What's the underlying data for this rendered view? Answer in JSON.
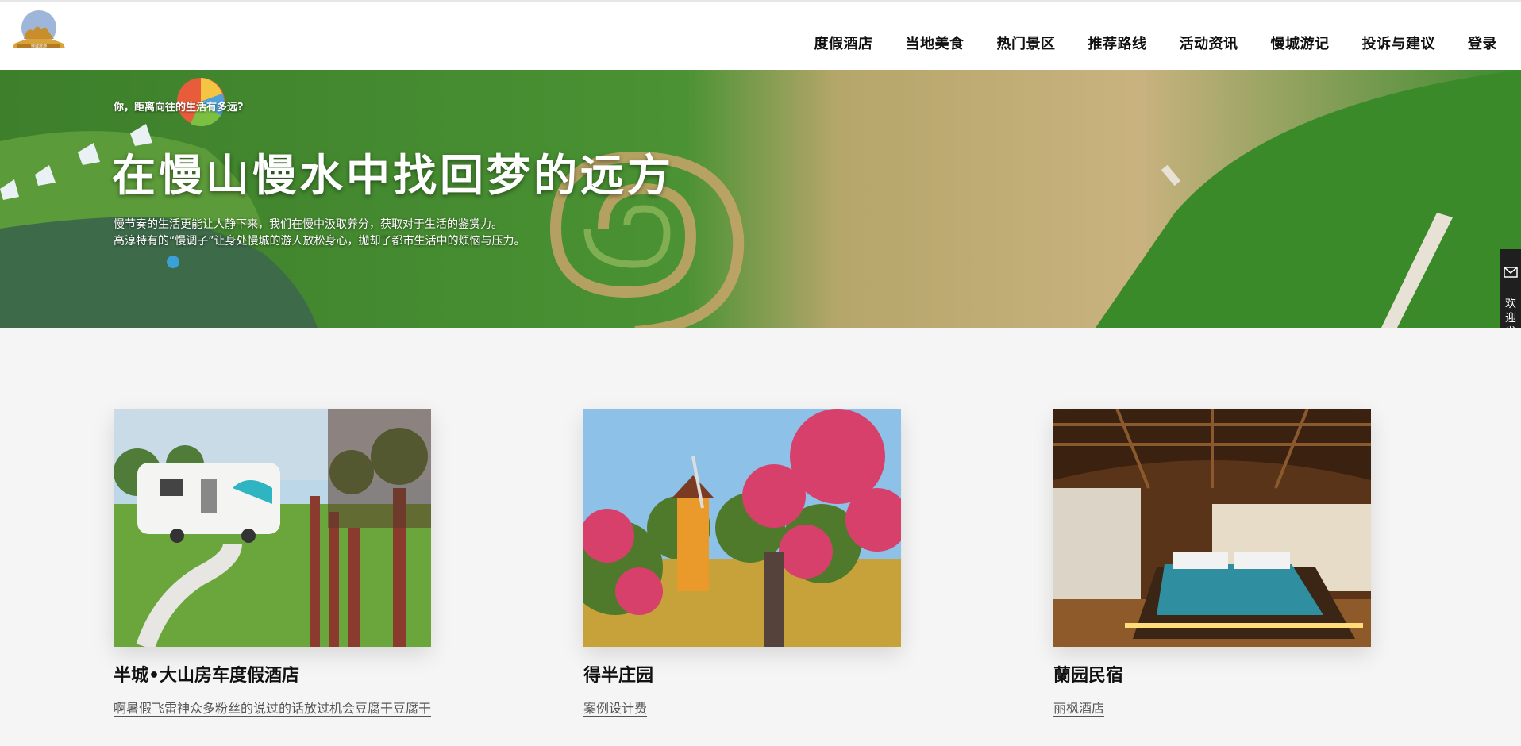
{
  "header": {
    "logo_icon": "camel-logo-icon",
    "nav": [
      {
        "label": "度假酒店"
      },
      {
        "label": "当地美食"
      },
      {
        "label": "热门景区"
      },
      {
        "label": "推荐路线"
      },
      {
        "label": "活动资讯"
      },
      {
        "label": "慢城游记"
      },
      {
        "label": "投诉与建议"
      },
      {
        "label": "登录"
      }
    ]
  },
  "hero": {
    "eyebrow": "你，距离向往的生活有多远?",
    "title": "在慢山慢水中找回梦的远方",
    "desc_line1": "慢节奏的生活更能让人静下来，我们在慢中汲取养分，获取对于生活的鉴赏力。",
    "desc_line2": "高淳特有的“慢调子”让身处慢城的游人放松身心，抛却了都市生活中的烦恼与压力。"
  },
  "feedback": {
    "icon": "mail-icon",
    "label": "欢迎发表反馈意见"
  },
  "cards": [
    {
      "title": "半城•大山房车度假酒店",
      "desc": "啊暑假飞雷神众多粉丝的说过的话放过机会豆腐干豆腐干"
    },
    {
      "title": "得半庄园",
      "desc": "案例设计费"
    },
    {
      "title": "蘭园民宿",
      "desc": "丽枫酒店"
    }
  ],
  "colors": {
    "header_bg": "#ffffff",
    "page_bg": "#f5f5f5",
    "feedback_bg": "#1f1f1f",
    "hero_green": "#3f8f2a"
  }
}
